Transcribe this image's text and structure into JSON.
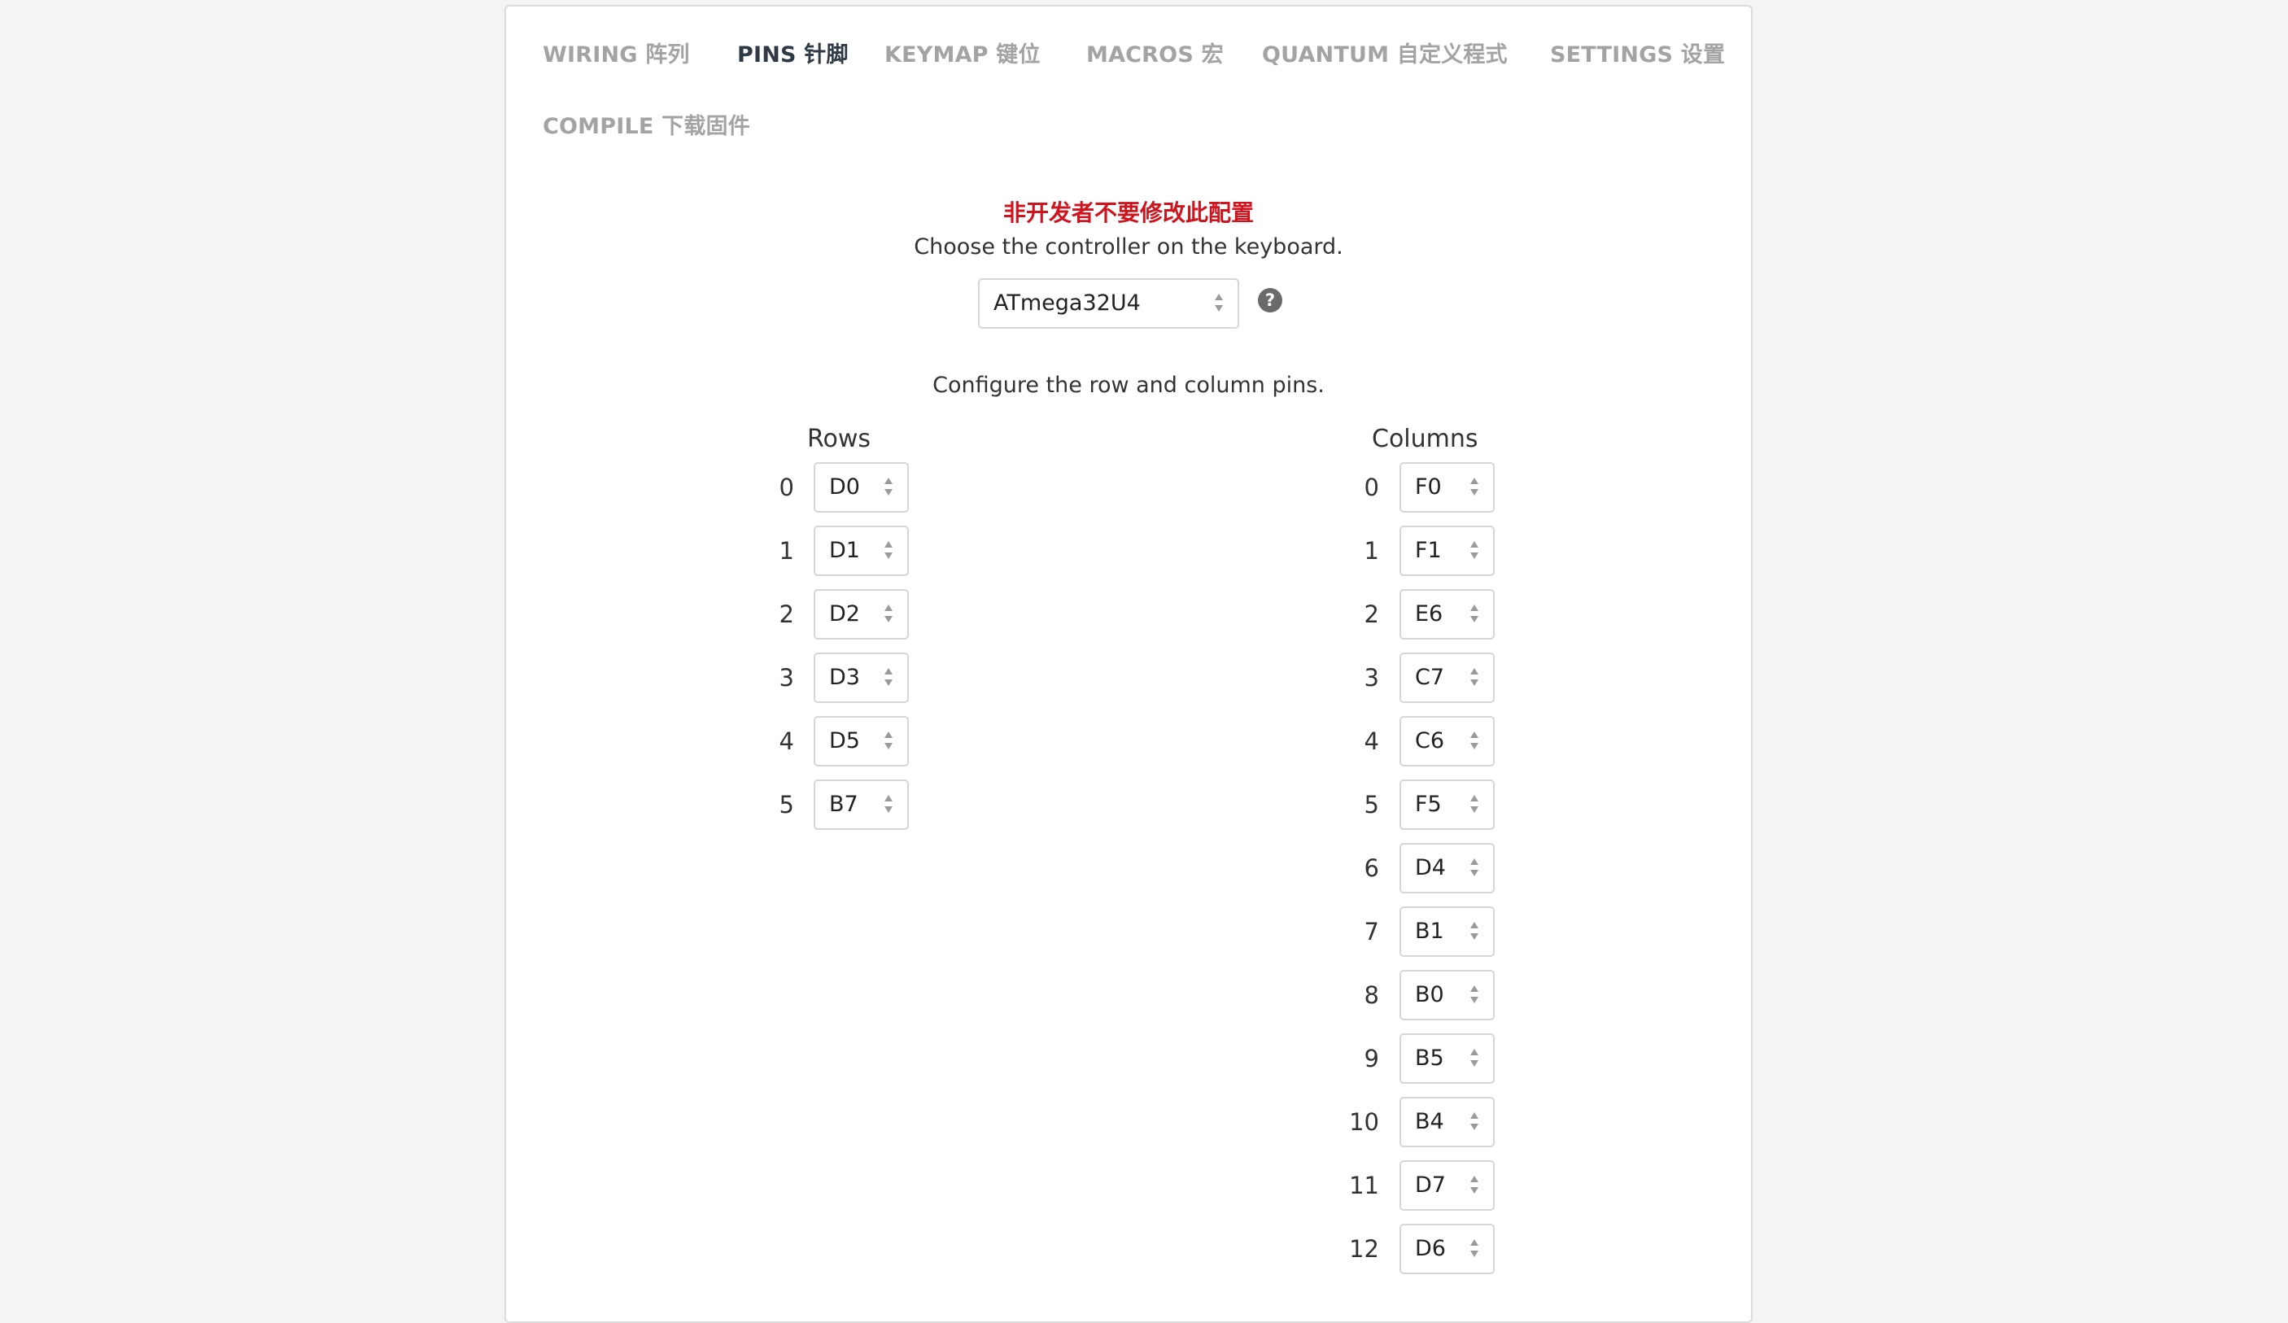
{
  "tabs": [
    {
      "label": "WIRING 阵列",
      "active": false
    },
    {
      "label": "PINS 针脚",
      "active": true
    },
    {
      "label": "KEYMAP 键位",
      "active": false
    },
    {
      "label": "MACROS 宏",
      "active": false
    },
    {
      "label": "QUANTUM 自定义程式",
      "active": false
    },
    {
      "label": "SETTINGS 设置",
      "active": false
    },
    {
      "label": "COMPILE 下载固件",
      "active": false
    }
  ],
  "warning": "非开发者不要修改此配置",
  "controller": {
    "prompt": "Choose the controller on the keyboard.",
    "value": "ATmega32U4",
    "help_icon": "question-circle-icon"
  },
  "pins": {
    "prompt": "Configure the row and column pins.",
    "rows_header": "Rows",
    "columns_header": "Columns",
    "rows": [
      {
        "index": "0",
        "pin": "D0"
      },
      {
        "index": "1",
        "pin": "D1"
      },
      {
        "index": "2",
        "pin": "D2"
      },
      {
        "index": "3",
        "pin": "D3"
      },
      {
        "index": "4",
        "pin": "D5"
      },
      {
        "index": "5",
        "pin": "B7"
      }
    ],
    "columns": [
      {
        "index": "0",
        "pin": "F0"
      },
      {
        "index": "1",
        "pin": "F1"
      },
      {
        "index": "2",
        "pin": "E6"
      },
      {
        "index": "3",
        "pin": "C7"
      },
      {
        "index": "4",
        "pin": "C6"
      },
      {
        "index": "5",
        "pin": "F5"
      },
      {
        "index": "6",
        "pin": "D4"
      },
      {
        "index": "7",
        "pin": "B1"
      },
      {
        "index": "8",
        "pin": "B0"
      },
      {
        "index": "9",
        "pin": "B5"
      },
      {
        "index": "10",
        "pin": "B4"
      },
      {
        "index": "11",
        "pin": "D7"
      },
      {
        "index": "12",
        "pin": "D6"
      }
    ]
  },
  "colors": {
    "warning": "#d0141e",
    "active_tab": "#2f3a45",
    "inactive_tab": "#a3a3a3"
  }
}
